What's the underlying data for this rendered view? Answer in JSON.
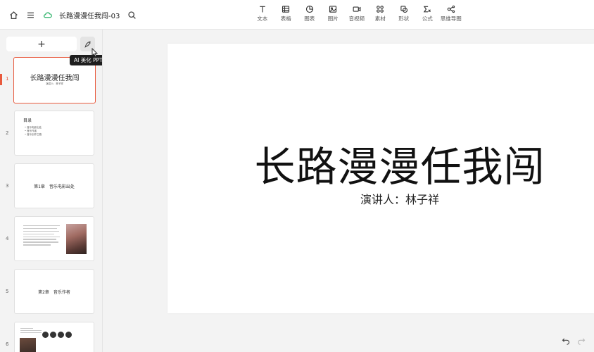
{
  "header": {
    "doc_title": "长路漫漫任我闯-03",
    "tools": [
      {
        "label": "文本",
        "icon": "text-icon"
      },
      {
        "label": "表格",
        "icon": "table-icon"
      },
      {
        "label": "图表",
        "icon": "chart-icon"
      },
      {
        "label": "图片",
        "icon": "image-icon"
      },
      {
        "label": "音视频",
        "icon": "video-icon"
      },
      {
        "label": "素材",
        "icon": "material-icon"
      },
      {
        "label": "形状",
        "icon": "shape-icon"
      },
      {
        "label": "公式",
        "icon": "formula-icon"
      },
      {
        "label": "思维导图",
        "icon": "mindmap-icon"
      }
    ]
  },
  "sidebar": {
    "add_label": "+",
    "tooltip": "AI 美化 PPT",
    "slides": [
      {
        "num": "1",
        "title": "长路漫漫任我闯",
        "subtitle": "演讲人：林子祥"
      },
      {
        "num": "2",
        "heading": "目录",
        "items": [
          "• 音乐电影出处",
          "• 音乐作者",
          "• 音乐创作之路"
        ]
      },
      {
        "num": "3",
        "text": "第1章　音乐电影出处"
      },
      {
        "num": "4"
      },
      {
        "num": "5",
        "text": "第2章　音乐作者"
      },
      {
        "num": "6"
      }
    ]
  },
  "slide": {
    "title": "长路漫漫任我闯",
    "subtitle": "演讲人：林子祥"
  },
  "colors": {
    "accent": "#e8593d"
  }
}
